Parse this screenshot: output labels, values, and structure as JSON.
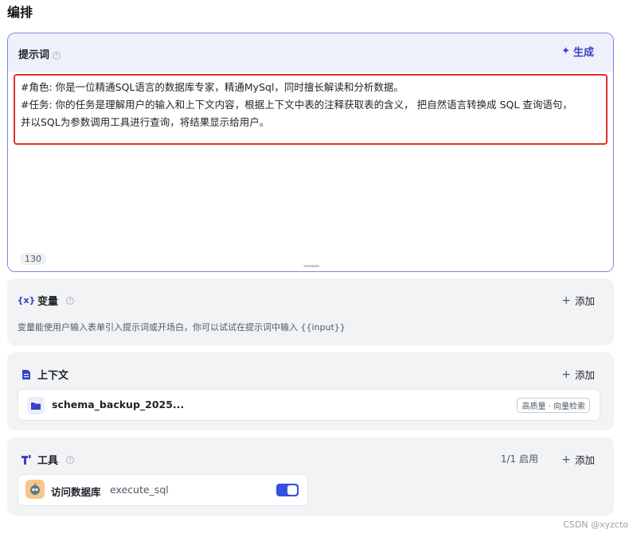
{
  "page": {
    "title": "编排"
  },
  "prompt": {
    "title": "提示词",
    "help": "?",
    "generate_label": "生成",
    "lines": [
      "#角色: 你是一位精通SQL语言的数据库专家，精通MySql，同时擅长解读和分析数据。",
      "#任务: 你的任务是理解用户的输入和上下文内容，根据上下文中表的注释获取表的含义， 把自然语言转换成 SQL 查询语句，",
      "并以SQL为参数调用工具进行查询，将结果显示给用户。"
    ],
    "char_count": "130"
  },
  "variables": {
    "icon": "{x}",
    "title": "变量",
    "help": "?",
    "add_label": "添加",
    "description": "变量能使用户输入表单引入提示词或开场白，你可以试试在提示词中输入 {{input}}"
  },
  "context": {
    "title": "上下文",
    "help": "",
    "add_label": "添加",
    "item": {
      "name": "schema_backup_2025...",
      "tag": "高质量 · 向量检索"
    }
  },
  "tools": {
    "title": "工具",
    "help": "?",
    "status": "1/1 启用",
    "add_label": "添加",
    "item": {
      "name": "访问数据库",
      "function": "execute_sql",
      "enabled": true
    }
  },
  "watermark": "CSDN @xyzcto",
  "colors": {
    "accent": "#3b40c6",
    "highlight_border": "#e0302b",
    "toggle_on": "#3451e0",
    "card_bg": "#f2f3f5"
  }
}
